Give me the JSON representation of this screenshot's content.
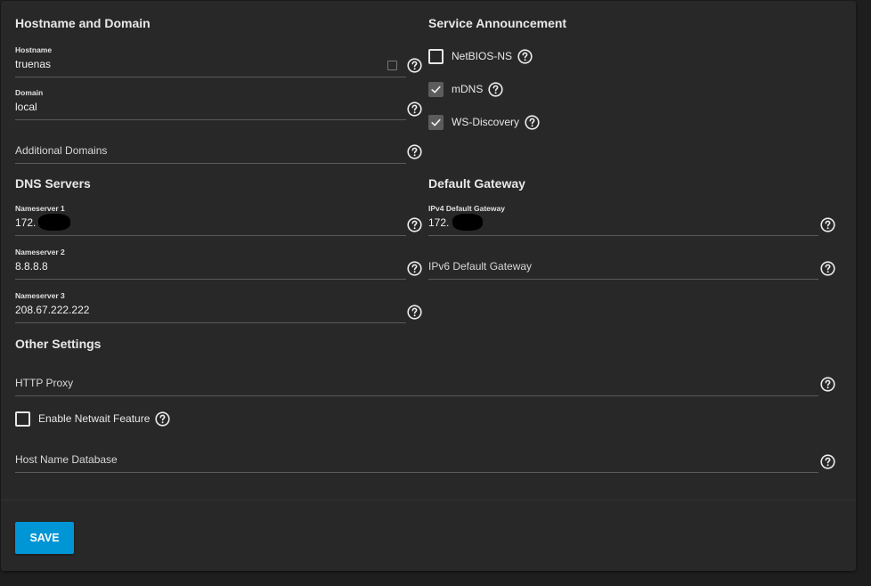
{
  "sections": {
    "hostname_domain": "Hostname and Domain",
    "service_announcement": "Service Announcement",
    "dns_servers": "DNS Servers",
    "default_gateway": "Default Gateway",
    "other_settings": "Other Settings"
  },
  "fields": {
    "hostname": {
      "label": "Hostname",
      "value": "truenas"
    },
    "domain": {
      "label": "Domain",
      "value": "local"
    },
    "additional_domains": {
      "placeholder": "Additional Domains"
    },
    "nameserver1": {
      "label": "Nameserver 1",
      "value": "172.  1"
    },
    "nameserver2": {
      "label": "Nameserver 2",
      "value": "8.8.8.8"
    },
    "nameserver3": {
      "label": "Nameserver 3",
      "value": "208.67.222.222"
    },
    "ipv4_gateway": {
      "label": "IPv4 Default Gateway",
      "value": "172.  1"
    },
    "ipv6_gateway": {
      "placeholder": "IPv6 Default Gateway"
    },
    "http_proxy": {
      "placeholder": "HTTP Proxy"
    },
    "host_name_database": {
      "placeholder": "Host Name Database"
    }
  },
  "checkboxes": {
    "netbios": {
      "label": "NetBIOS-NS",
      "checked": false
    },
    "mdns": {
      "label": "mDNS",
      "checked": true
    },
    "ws_discovery": {
      "label": "WS-Discovery",
      "checked": true
    },
    "netwait": {
      "label": "Enable Netwait Feature",
      "checked": false
    }
  },
  "buttons": {
    "save": "SAVE"
  },
  "colors": {
    "background": "#1e1e1e",
    "card": "#282828",
    "primary": "#0095d5",
    "underline": "#5a5a5a"
  },
  "icons": {
    "help": "help-circle-icon",
    "check": "check-icon",
    "keyboard": "keyboard-icon"
  }
}
